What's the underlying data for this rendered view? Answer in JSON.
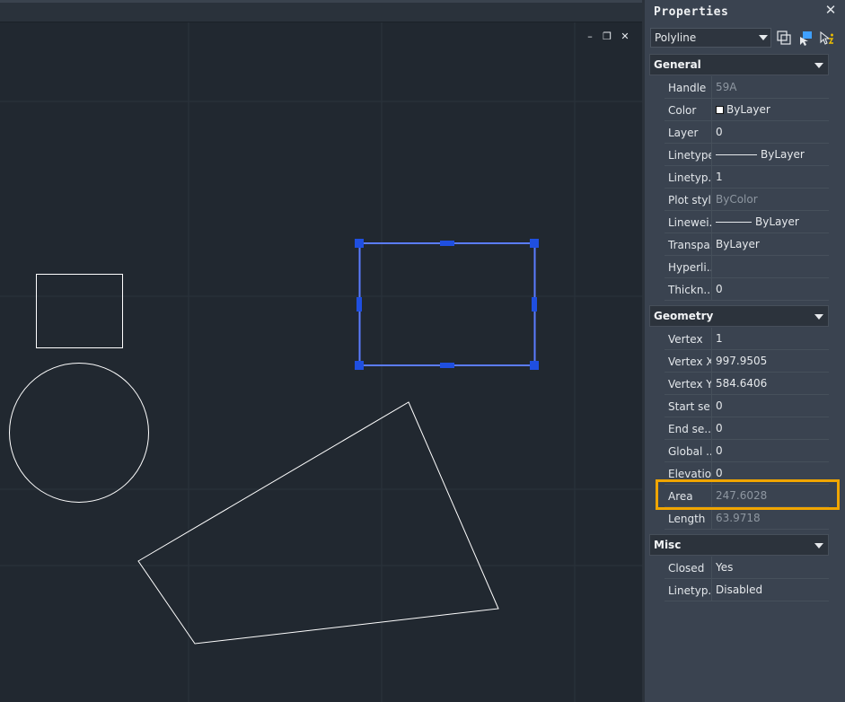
{
  "window_controls": {
    "minimize": "–",
    "restore": "❐",
    "close": "✕"
  },
  "panel": {
    "title": "Properties",
    "close_glyph": "✕",
    "object_type": "Polyline",
    "toolbar_icons": [
      "select-objects-icon",
      "quick-select-icon",
      "toggle-pickadd-icon"
    ]
  },
  "sections": {
    "general": {
      "title": "General",
      "rows": [
        {
          "name": "Handle",
          "value": "59A"
        },
        {
          "name": "Color",
          "value": "ByLayer"
        },
        {
          "name": "Layer",
          "value": "0"
        },
        {
          "name": "Linetype",
          "value": "ByLayer"
        },
        {
          "name": "Linetyp...",
          "value": "1"
        },
        {
          "name": "Plot style",
          "value": "ByColor"
        },
        {
          "name": "Linewei...",
          "value": "ByLayer"
        },
        {
          "name": "Transpa...",
          "value": "ByLayer"
        },
        {
          "name": "Hyperli...",
          "value": ""
        },
        {
          "name": "Thickn...",
          "value": "0"
        }
      ]
    },
    "geometry": {
      "title": "Geometry",
      "rows": [
        {
          "name": "Vertex",
          "value": "1"
        },
        {
          "name": "Vertex X",
          "value": "997.9505"
        },
        {
          "name": "Vertex Y",
          "value": "584.6406"
        },
        {
          "name": "Start se...",
          "value": "0"
        },
        {
          "name": "End se...",
          "value": "0"
        },
        {
          "name": "Global ...",
          "value": "0"
        },
        {
          "name": "Elevation",
          "value": "0"
        },
        {
          "name": "Area",
          "value": "247.6028"
        },
        {
          "name": "Length",
          "value": "63.9718"
        }
      ]
    },
    "misc": {
      "title": "Misc",
      "rows": [
        {
          "name": "Closed",
          "value": "Yes"
        },
        {
          "name": "Linetyp...",
          "value": "Disabled"
        }
      ]
    }
  },
  "colors": {
    "canvas_bg": "#212830",
    "grid": "#2b333c",
    "selection": "#5b7cff",
    "grip": "#1f4fe0",
    "highlight": "#f0a500",
    "entity": "#ffffff"
  }
}
